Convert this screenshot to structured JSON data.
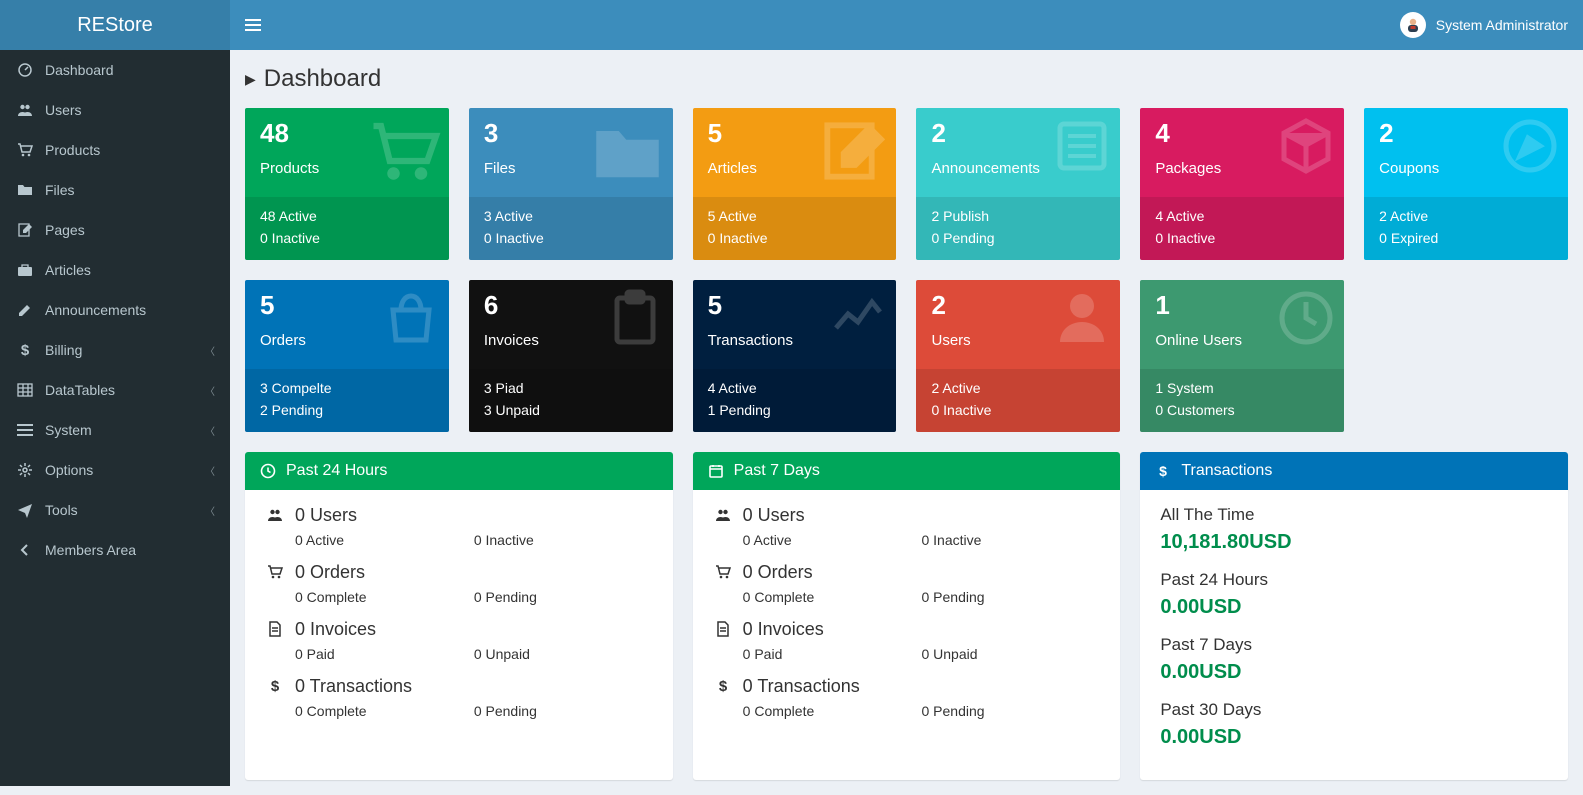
{
  "brand": "REStore",
  "user_name": "System Administrator",
  "page_title": "Dashboard",
  "sidebar": {
    "items": [
      {
        "label": "Dashboard",
        "icon": "dashboard",
        "expandable": false
      },
      {
        "label": "Users",
        "icon": "users",
        "expandable": false
      },
      {
        "label": "Products",
        "icon": "cart",
        "expandable": false
      },
      {
        "label": "Files",
        "icon": "folder",
        "expandable": false
      },
      {
        "label": "Pages",
        "icon": "edit",
        "expandable": false
      },
      {
        "label": "Articles",
        "icon": "briefcase",
        "expandable": false
      },
      {
        "label": "Announcements",
        "icon": "pencil",
        "expandable": false
      },
      {
        "label": "Billing",
        "icon": "dollar",
        "expandable": true
      },
      {
        "label": "DataTables",
        "icon": "table",
        "expandable": true
      },
      {
        "label": "System",
        "icon": "bars",
        "expandable": true
      },
      {
        "label": "Options",
        "icon": "cogs",
        "expandable": true
      },
      {
        "label": "Tools",
        "icon": "plane",
        "expandable": true
      },
      {
        "label": "Members Area",
        "icon": "back",
        "expandable": false
      }
    ]
  },
  "cards_row1": [
    {
      "num": "48",
      "label": "Products",
      "l1": "48 Active",
      "l2": "0 Inactive",
      "color": "c-green",
      "icon": "cart"
    },
    {
      "num": "3",
      "label": "Files",
      "l1": "3 Active",
      "l2": "0 Inactive",
      "color": "c-blue",
      "icon": "folder"
    },
    {
      "num": "5",
      "label": "Articles",
      "l1": "5 Active",
      "l2": "0 Inactive",
      "color": "c-orange",
      "icon": "edit"
    },
    {
      "num": "2",
      "label": "Announcements",
      "l1": "2 Publish",
      "l2": "0 Pending",
      "color": "c-sky",
      "icon": "list"
    },
    {
      "num": "4",
      "label": "Packages",
      "l1": "4 Active",
      "l2": "0 Inactive",
      "color": "c-pink",
      "icon": "cube"
    },
    {
      "num": "2",
      "label": "Coupons",
      "l1": "2 Active",
      "l2": "0 Expired",
      "color": "c-teal",
      "icon": "compass"
    }
  ],
  "cards_row2": [
    {
      "num": "5",
      "label": "Orders",
      "l1": "3 Compelte",
      "l2": "2 Pending",
      "color": "c-blue2",
      "icon": "bag"
    },
    {
      "num": "6",
      "label": "Invoices",
      "l1": "3 Piad",
      "l2": "3 Unpaid",
      "color": "c-black",
      "icon": "clipboard"
    },
    {
      "num": "5",
      "label": "Transactions",
      "l1": "4 Active",
      "l2": "1 Pending",
      "color": "c-navy",
      "icon": "chart"
    },
    {
      "num": "2",
      "label": "Users",
      "l1": "2 Active",
      "l2": "0 Inactive",
      "color": "c-red",
      "icon": "user"
    },
    {
      "num": "1",
      "label": "Online Users",
      "l1": "1 System",
      "l2": "0 Customers",
      "color": "c-olive",
      "icon": "clock"
    }
  ],
  "panel24": {
    "title": "Past 24 Hours",
    "rows": [
      {
        "head": "0 Users",
        "a": "0 Active",
        "b": "0 Inactive",
        "icon": "users"
      },
      {
        "head": "0 Orders",
        "a": "0 Complete",
        "b": "0 Pending",
        "icon": "cart"
      },
      {
        "head": "0 Invoices",
        "a": "0 Paid",
        "b": "0 Unpaid",
        "icon": "file"
      },
      {
        "head": "0 Transactions",
        "a": "0 Complete",
        "b": "0 Pending",
        "icon": "dollar"
      }
    ]
  },
  "panel7": {
    "title": "Past 7 Days",
    "rows": [
      {
        "head": "0 Users",
        "a": "0 Active",
        "b": "0 Inactive",
        "icon": "users"
      },
      {
        "head": "0 Orders",
        "a": "0 Complete",
        "b": "0 Pending",
        "icon": "cart"
      },
      {
        "head": "0 Invoices",
        "a": "0 Paid",
        "b": "0 Unpaid",
        "icon": "file"
      },
      {
        "head": "0 Transactions",
        "a": "0 Complete",
        "b": "0 Pending",
        "icon": "dollar"
      }
    ]
  },
  "panelTx": {
    "title": "Transactions",
    "rows": [
      {
        "label": "All The Time",
        "val": "10,181.80USD"
      },
      {
        "label": "Past 24 Hours",
        "val": "0.00USD"
      },
      {
        "label": "Past 7 Days",
        "val": "0.00USD"
      },
      {
        "label": "Past 30 Days",
        "val": "0.00USD"
      }
    ]
  }
}
